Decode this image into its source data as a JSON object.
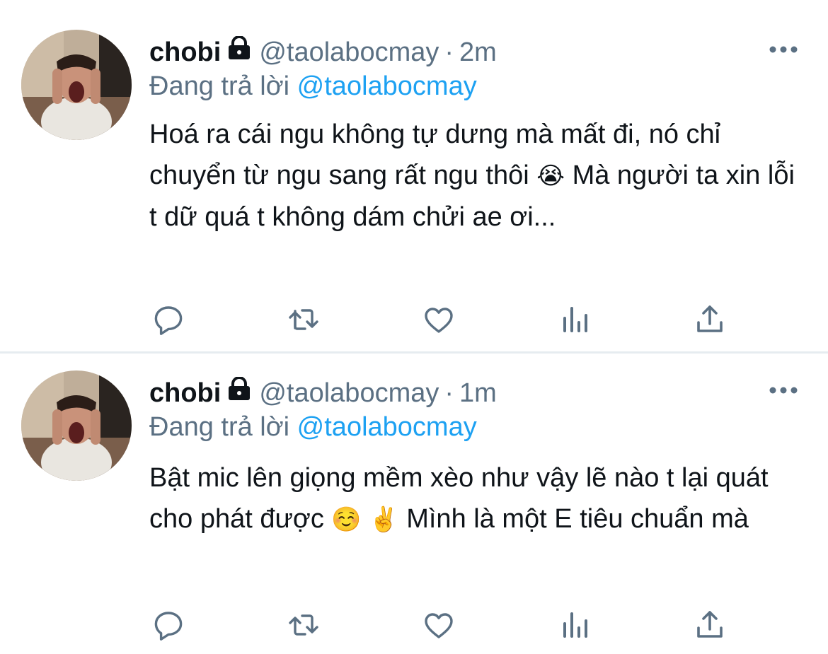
{
  "colors": {
    "text": "#0f1419",
    "secondary": "#5b7083",
    "link": "#1da1f2",
    "divider": "#e6ecf0"
  },
  "tweets": [
    {
      "name": "chobi",
      "handle": "@taolabocmay",
      "separator": "·",
      "time": "2m",
      "reply_prefix": "Đang trả lời",
      "reply_to": "@taolabocmay",
      "text_parts": [
        "Hoá ra cái ngu không tự dưng mà mất đi, nó chỉ chuyển từ ngu sang rất ngu thôi",
        "😭",
        " Mà người ta xin lỗi t dữ quá t không dám chửi ae ơi..."
      ],
      "icons": [
        "lock-icon",
        "more-icon",
        "reply-icon",
        "retweet-icon",
        "like-icon",
        "analytics-icon",
        "share-icon"
      ]
    },
    {
      "name": "chobi",
      "handle": "@taolabocmay",
      "separator": "·",
      "time": "1m",
      "reply_prefix": "Đang trả lời",
      "reply_to": "@taolabocmay",
      "text_parts": [
        "Bật mic lên giọng mềm xèo như vậy lẽ nào t lại quát cho phát được",
        "☺️",
        "✌️",
        " Mình là một E tiêu chuẩn mà"
      ],
      "icons": [
        "lock-icon",
        "more-icon",
        "reply-icon",
        "retweet-icon",
        "like-icon",
        "analytics-icon",
        "share-icon"
      ]
    }
  ]
}
